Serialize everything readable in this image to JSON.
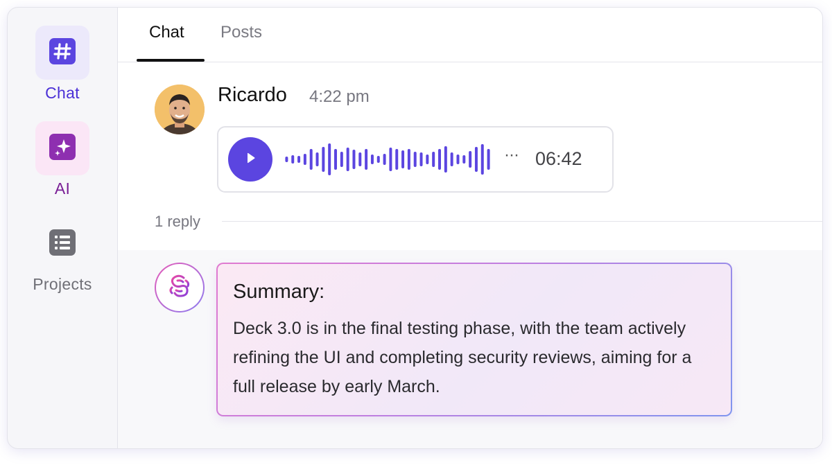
{
  "sidebar": {
    "items": [
      {
        "label": "Chat",
        "icon": "hash-icon",
        "active": true
      },
      {
        "label": "AI",
        "icon": "sparkles-icon",
        "active": false
      },
      {
        "label": "Projects",
        "icon": "list-icon",
        "active": false
      }
    ]
  },
  "tabs": [
    {
      "label": "Chat",
      "active": true
    },
    {
      "label": "Posts",
      "active": false
    }
  ],
  "message": {
    "author": "Ricardo",
    "time": "4:22 pm",
    "voice_note": {
      "duration": "06:42",
      "more_label": "···"
    },
    "reply_count_label": "1 reply"
  },
  "summary": {
    "title": "Summary:",
    "body": "Deck 3.0 is in the final testing phase, with the team actively refining the UI and completing security reviews, aiming for a full release by early March."
  },
  "colors": {
    "chat_accent": "#5b45e0",
    "ai_accent": "#8e2fb0",
    "projects_gray": "#6f6f76",
    "summary_gradient_start": "#e07ad0",
    "summary_gradient_end": "#7f95ef"
  }
}
